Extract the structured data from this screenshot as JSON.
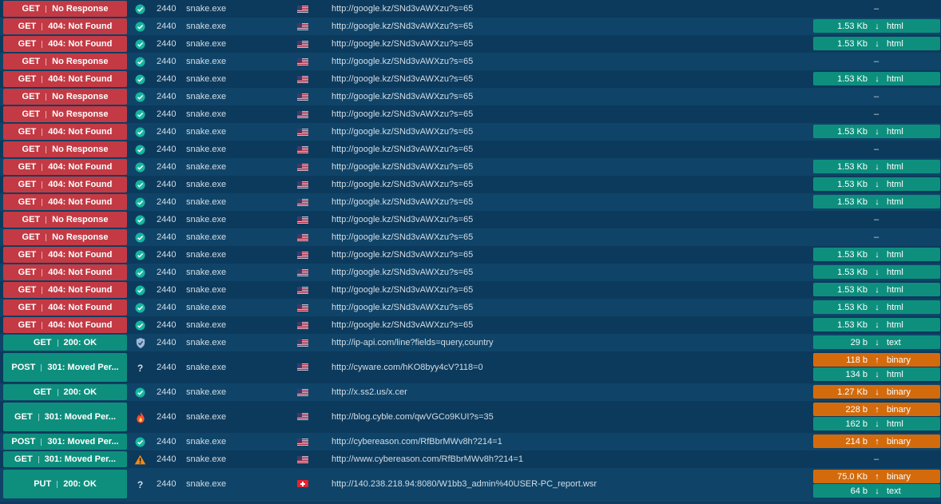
{
  "colors": {
    "error_status": "#c33a44",
    "ok_status": "#0e8f7e",
    "download_badge": "#0e8f7e",
    "upload_badge": "#d36b0d",
    "row_bg": "#0c3a5c",
    "row_bg_alt": "#0f4468"
  },
  "rows": [
    {
      "method": "GET",
      "status": "No Response",
      "kind": "err",
      "rep": "check",
      "pid": "2440",
      "process": "snake.exe",
      "flag": "us",
      "url": "http://google.kz/SNd3vAWXzu?s=65",
      "sizes": []
    },
    {
      "method": "GET",
      "status": "404: Not Found",
      "kind": "err",
      "rep": "check",
      "pid": "2440",
      "process": "snake.exe",
      "flag": "us",
      "url": "http://google.kz/SNd3vAWXzu?s=65",
      "sizes": [
        {
          "size": "1.53 Kb",
          "dir": "down",
          "mime": "html"
        }
      ]
    },
    {
      "method": "GET",
      "status": "404: Not Found",
      "kind": "err",
      "rep": "check",
      "pid": "2440",
      "process": "snake.exe",
      "flag": "us",
      "url": "http://google.kz/SNd3vAWXzu?s=65",
      "sizes": [
        {
          "size": "1.53 Kb",
          "dir": "down",
          "mime": "html"
        }
      ]
    },
    {
      "method": "GET",
      "status": "No Response",
      "kind": "err",
      "rep": "check",
      "pid": "2440",
      "process": "snake.exe",
      "flag": "us",
      "url": "http://google.kz/SNd3vAWXzu?s=65",
      "sizes": []
    },
    {
      "method": "GET",
      "status": "404: Not Found",
      "kind": "err",
      "rep": "check",
      "pid": "2440",
      "process": "snake.exe",
      "flag": "us",
      "url": "http://google.kz/SNd3vAWXzu?s=65",
      "sizes": [
        {
          "size": "1.53 Kb",
          "dir": "down",
          "mime": "html"
        }
      ]
    },
    {
      "method": "GET",
      "status": "No Response",
      "kind": "err",
      "rep": "check",
      "pid": "2440",
      "process": "snake.exe",
      "flag": "us",
      "url": "http://google.kz/SNd3vAWXzu?s=65",
      "sizes": []
    },
    {
      "method": "GET",
      "status": "No Response",
      "kind": "err",
      "rep": "check",
      "pid": "2440",
      "process": "snake.exe",
      "flag": "us",
      "url": "http://google.kz/SNd3vAWXzu?s=65",
      "sizes": []
    },
    {
      "method": "GET",
      "status": "404: Not Found",
      "kind": "err",
      "rep": "check",
      "pid": "2440",
      "process": "snake.exe",
      "flag": "us",
      "url": "http://google.kz/SNd3vAWXzu?s=65",
      "sizes": [
        {
          "size": "1.53 Kb",
          "dir": "down",
          "mime": "html"
        }
      ]
    },
    {
      "method": "GET",
      "status": "No Response",
      "kind": "err",
      "rep": "check",
      "pid": "2440",
      "process": "snake.exe",
      "flag": "us",
      "url": "http://google.kz/SNd3vAWXzu?s=65",
      "sizes": []
    },
    {
      "method": "GET",
      "status": "404: Not Found",
      "kind": "err",
      "rep": "check",
      "pid": "2440",
      "process": "snake.exe",
      "flag": "us",
      "url": "http://google.kz/SNd3vAWXzu?s=65",
      "sizes": [
        {
          "size": "1.53 Kb",
          "dir": "down",
          "mime": "html"
        }
      ]
    },
    {
      "method": "GET",
      "status": "404: Not Found",
      "kind": "err",
      "rep": "check",
      "pid": "2440",
      "process": "snake.exe",
      "flag": "us",
      "url": "http://google.kz/SNd3vAWXzu?s=65",
      "sizes": [
        {
          "size": "1.53 Kb",
          "dir": "down",
          "mime": "html"
        }
      ]
    },
    {
      "method": "GET",
      "status": "404: Not Found",
      "kind": "err",
      "rep": "check",
      "pid": "2440",
      "process": "snake.exe",
      "flag": "us",
      "url": "http://google.kz/SNd3vAWXzu?s=65",
      "sizes": [
        {
          "size": "1.53 Kb",
          "dir": "down",
          "mime": "html"
        }
      ]
    },
    {
      "method": "GET",
      "status": "No Response",
      "kind": "err",
      "rep": "check",
      "pid": "2440",
      "process": "snake.exe",
      "flag": "us",
      "url": "http://google.kz/SNd3vAWXzu?s=65",
      "sizes": []
    },
    {
      "method": "GET",
      "status": "No Response",
      "kind": "err",
      "rep": "check",
      "pid": "2440",
      "process": "snake.exe",
      "flag": "us",
      "url": "http://google.kz/SNd3vAWXzu?s=65",
      "sizes": []
    },
    {
      "method": "GET",
      "status": "404: Not Found",
      "kind": "err",
      "rep": "check",
      "pid": "2440",
      "process": "snake.exe",
      "flag": "us",
      "url": "http://google.kz/SNd3vAWXzu?s=65",
      "sizes": [
        {
          "size": "1.53 Kb",
          "dir": "down",
          "mime": "html"
        }
      ]
    },
    {
      "method": "GET",
      "status": "404: Not Found",
      "kind": "err",
      "rep": "check",
      "pid": "2440",
      "process": "snake.exe",
      "flag": "us",
      "url": "http://google.kz/SNd3vAWXzu?s=65",
      "sizes": [
        {
          "size": "1.53 Kb",
          "dir": "down",
          "mime": "html"
        }
      ]
    },
    {
      "method": "GET",
      "status": "404: Not Found",
      "kind": "err",
      "rep": "check",
      "pid": "2440",
      "process": "snake.exe",
      "flag": "us",
      "url": "http://google.kz/SNd3vAWXzu?s=65",
      "sizes": [
        {
          "size": "1.53 Kb",
          "dir": "down",
          "mime": "html"
        }
      ]
    },
    {
      "method": "GET",
      "status": "404: Not Found",
      "kind": "err",
      "rep": "check",
      "pid": "2440",
      "process": "snake.exe",
      "flag": "us",
      "url": "http://google.kz/SNd3vAWXzu?s=65",
      "sizes": [
        {
          "size": "1.53 Kb",
          "dir": "down",
          "mime": "html"
        }
      ]
    },
    {
      "method": "GET",
      "status": "404: Not Found",
      "kind": "err",
      "rep": "check",
      "pid": "2440",
      "process": "snake.exe",
      "flag": "us",
      "url": "http://google.kz/SNd3vAWXzu?s=65",
      "sizes": [
        {
          "size": "1.53 Kb",
          "dir": "down",
          "mime": "html"
        }
      ]
    },
    {
      "method": "GET",
      "status": "200: OK",
      "kind": "ok",
      "rep": "shield",
      "pid": "2440",
      "process": "snake.exe",
      "flag": "us",
      "url": "http://ip-api.com/line?fields=query,country",
      "sizes": [
        {
          "size": "29 b",
          "dir": "down",
          "mime": "text"
        }
      ]
    },
    {
      "method": "POST",
      "status": "301: Moved Per...",
      "kind": "ok",
      "rep": "unknown",
      "pid": "2440",
      "process": "snake.exe",
      "flag": "us",
      "url": "http://cyware.com/hKO8byy4cV?118=0",
      "sizes": [
        {
          "size": "118 b",
          "dir": "up",
          "mime": "binary"
        },
        {
          "size": "134 b",
          "dir": "down",
          "mime": "html"
        }
      ]
    },
    {
      "method": "GET",
      "status": "200: OK",
      "kind": "ok",
      "rep": "check",
      "pid": "2440",
      "process": "snake.exe",
      "flag": "us",
      "url": "http://x.ss2.us/x.cer",
      "sizes": [
        {
          "size": "1.27 Kb",
          "dir": "down",
          "mime": "binary",
          "badge": "up"
        }
      ]
    },
    {
      "method": "GET",
      "status": "301: Moved Per...",
      "kind": "ok",
      "rep": "fire",
      "pid": "2440",
      "process": "snake.exe",
      "flag": "us",
      "url": "http://blog.cyble.com/qwVGCo9KUI?s=35",
      "sizes": [
        {
          "size": "228 b",
          "dir": "up",
          "mime": "binary"
        },
        {
          "size": "162 b",
          "dir": "down",
          "mime": "html"
        }
      ]
    },
    {
      "method": "POST",
      "status": "301: Moved Per...",
      "kind": "ok",
      "rep": "check",
      "pid": "2440",
      "process": "snake.exe",
      "flag": "us",
      "url": "http://cybereason.com/RfBbrMWv8h?214=1",
      "sizes": [
        {
          "size": "214 b",
          "dir": "up",
          "mime": "binary"
        }
      ]
    },
    {
      "method": "GET",
      "status": "301: Moved Per...",
      "kind": "ok",
      "rep": "warning",
      "pid": "2440",
      "process": "snake.exe",
      "flag": "us",
      "url": "http://www.cybereason.com/RfBbrMWv8h?214=1",
      "sizes": []
    },
    {
      "method": "PUT",
      "status": "200: OK",
      "kind": "ok",
      "rep": "unknown",
      "pid": "2440",
      "process": "snake.exe",
      "flag": "ch",
      "url": "http://140.238.218.94:8080/W1bb3_admin%40USER-PC_report.wsr",
      "sizes": [
        {
          "size": "75.0 Kb",
          "dir": "up",
          "mime": "binary"
        },
        {
          "size": "64 b",
          "dir": "down",
          "mime": "text"
        }
      ]
    }
  ],
  "empty_size": "–",
  "unknown_glyph": "?",
  "arrow_down": "↓",
  "arrow_up": "↑"
}
